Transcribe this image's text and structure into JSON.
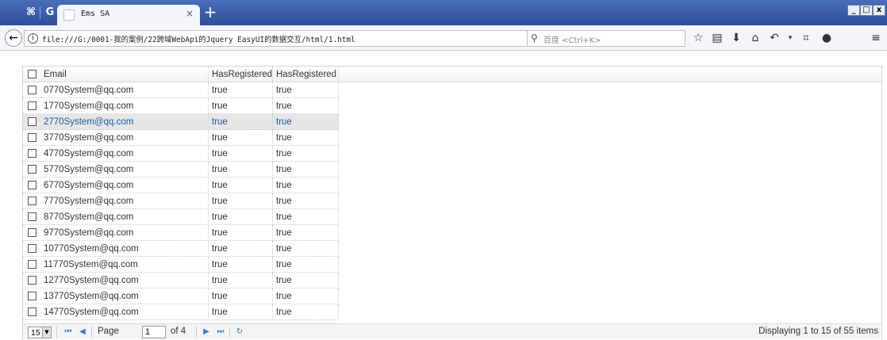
{
  "browser": {
    "tab_title": "Ems SA",
    "tab_close": "×",
    "new_tab": "+",
    "url": "file:///G:/0001-我的案例/22跨域WebApi的Jquery EasyUI的数据交互/html/1.html",
    "search_placeholder": "百度 <Ctrl+K>",
    "window_buttons": [
      "_",
      "□",
      "x"
    ],
    "icons": [
      "bookmark-star-icon",
      "reading-list-icon",
      "download-icon",
      "home-icon",
      "undo-icon",
      "dropdown-icon",
      "screenshot-icon",
      "chat-icon",
      "menu-icon"
    ]
  },
  "grid": {
    "columns": [
      "Email",
      "HasRegistered",
      "HasRegistered"
    ],
    "selected_row": 2,
    "rows": [
      [
        "0770System@qq.com",
        "true",
        "true"
      ],
      [
        "1770System@qq.com",
        "true",
        "true"
      ],
      [
        "2770System@qq.com",
        "true",
        "true"
      ],
      [
        "3770System@qq.com",
        "true",
        "true"
      ],
      [
        "4770System@qq.com",
        "true",
        "true"
      ],
      [
        "5770System@qq.com",
        "true",
        "true"
      ],
      [
        "6770System@qq.com",
        "true",
        "true"
      ],
      [
        "7770System@qq.com",
        "true",
        "true"
      ],
      [
        "8770System@qq.com",
        "true",
        "true"
      ],
      [
        "9770System@qq.com",
        "true",
        "true"
      ],
      [
        "10770System@qq.com",
        "true",
        "true"
      ],
      [
        "11770System@qq.com",
        "true",
        "true"
      ],
      [
        "12770System@qq.com",
        "true",
        "true"
      ],
      [
        "13770System@qq.com",
        "true",
        "true"
      ],
      [
        "14770System@qq.com",
        "true",
        "true"
      ]
    ]
  },
  "pager": {
    "page_size": "15",
    "page_label": "Page",
    "page_value": "1",
    "of_label": "of 4",
    "info": "Displaying 1 to 15 of 55 items"
  },
  "colors": {
    "titlebar": "#2e4f9a",
    "selected_row": "#e6e6e6",
    "selected_text": "#1c5a9e",
    "pager_icon": "#3d7bd1"
  }
}
